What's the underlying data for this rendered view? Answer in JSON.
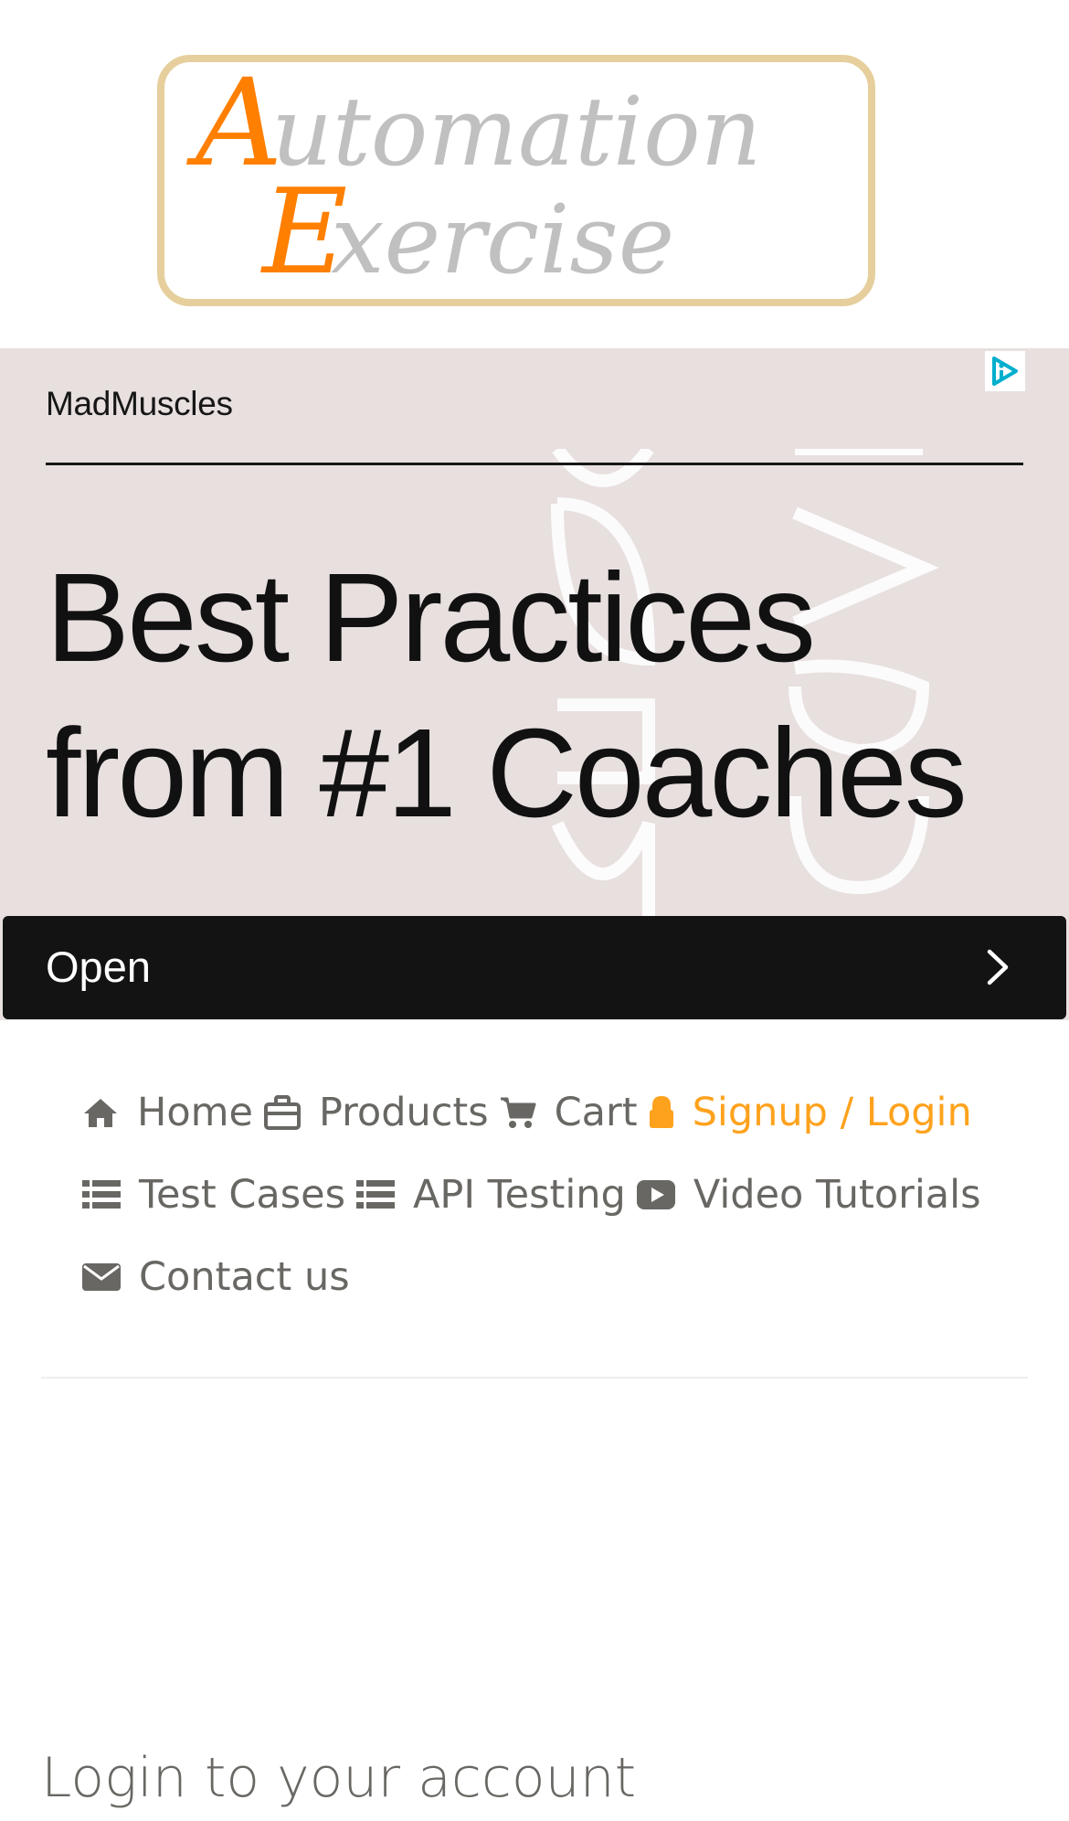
{
  "logo": {
    "line1": "Automation",
    "line2": "Exercise",
    "accent_color": "#ff7f00",
    "text_color": "#c0c0c0",
    "border_color": "#e6cf9d"
  },
  "ad": {
    "brand": "MadMuscles",
    "headline_line1": "Best Practices",
    "headline_line2": "from #1 Coaches",
    "cta_label": "Open",
    "background_color": "#e8dfdf",
    "cta_color": "#131313",
    "badge_icon": "adchoices-icon"
  },
  "nav": {
    "text_color": "#696763",
    "active_color": "#fea21d",
    "items": [
      {
        "label": "Home",
        "icon": "home-icon"
      },
      {
        "label": "Products",
        "icon": "briefcase-icon"
      },
      {
        "label": "Cart",
        "icon": "cart-icon"
      },
      {
        "label": "Signup / Login",
        "icon": "lock-icon",
        "active": true
      },
      {
        "label": "Test Cases",
        "icon": "list-icon"
      },
      {
        "label": "API Testing",
        "icon": "list-icon"
      },
      {
        "label": "Video Tutorials",
        "icon": "youtube-play-icon"
      },
      {
        "label": "Contact us",
        "icon": "envelope-icon"
      }
    ]
  },
  "login": {
    "title": "Login to your account"
  }
}
